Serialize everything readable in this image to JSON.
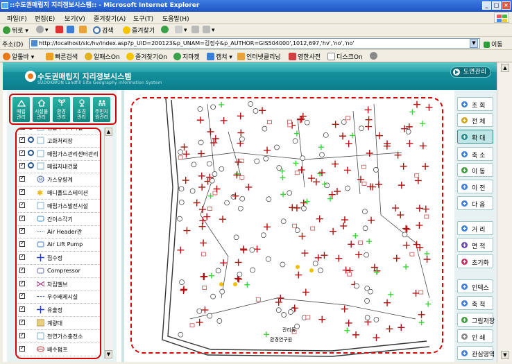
{
  "window": {
    "title": "::수도권매립지 지리정보시스템:: - Microsoft Internet Explorer",
    "controls": [
      "_",
      "□",
      "×"
    ]
  },
  "menu": [
    "파일(F)",
    "편집(E)",
    "보기(V)",
    "즐겨찾기(A)",
    "도구(T)",
    "도움말(H)"
  ],
  "toolbar": {
    "back": "뒤로",
    "search": "검색",
    "favorites": "즐겨찾기"
  },
  "address": {
    "label": "주소(D)",
    "url": "http://localhost/slc/hv/index.asp?p_UID=200123&p_UNAM=김정수&p_AUTHOR=GIS504000',1012,697,'hv','no','no'",
    "go": "이동"
  },
  "links": [
    "알툴바",
    "빠른검색",
    "알패스On",
    "즐겨찾기On",
    "지마켓",
    "캡쳐",
    "인터넷클리닝",
    "영한사전",
    "디스크On"
  ],
  "app": {
    "title": "수도권매립지 지리정보시스템",
    "subtitle": "SUDOKWON Landfill Site Geography Information System",
    "drawing_button": "도면관리"
  },
  "categories": [
    {
      "line1": "매립",
      "line2": "관리",
      "icon": "landfill-icon"
    },
    {
      "line1": "시설물",
      "line2": "관리",
      "icon": "facility-icon"
    },
    {
      "line1": "환경",
      "line2": "관리",
      "icon": "environment-icon"
    },
    {
      "line1": "조경",
      "line2": "관리",
      "icon": "landscape-icon"
    },
    {
      "line1": "주민지",
      "line2": "원관리",
      "icon": "residents-icon"
    }
  ],
  "layers": [
    {
      "name": "침출수저리시설",
      "magnifier": true,
      "icon": "square-icon"
    },
    {
      "name": "고화처리장",
      "magnifier": true,
      "icon": "square-icon"
    },
    {
      "name": "매립가스관리센터관리",
      "magnifier": true,
      "icon": "square-icon"
    },
    {
      "name": "매립지내건물",
      "magnifier": true,
      "icon": "square-icon"
    },
    {
      "name": "가스유량계",
      "magnifier": false,
      "icon": "circle-m-icon"
    },
    {
      "name": "매니폴드스테이션",
      "magnifier": false,
      "icon": "star-icon"
    },
    {
      "name": "매립가스발전시설",
      "magnifier": false,
      "icon": "square-icon"
    },
    {
      "name": "간이소각기",
      "magnifier": false,
      "icon": "burner-icon"
    },
    {
      "name": "Air Header관",
      "magnifier": false,
      "icon": "dotted-line-icon"
    },
    {
      "name": "Air Lift Pump",
      "magnifier": false,
      "icon": "pump-icon"
    },
    {
      "name": "집수정",
      "magnifier": false,
      "icon": "blue-cross-icon"
    },
    {
      "name": "Compressor",
      "magnifier": false,
      "icon": "compressor-icon"
    },
    {
      "name": "차집벨브",
      "magnifier": false,
      "icon": "valve-icon"
    },
    {
      "name": "우수배제시설",
      "magnifier": false,
      "icon": "dashed-line-icon"
    },
    {
      "name": "유출정",
      "magnifier": false,
      "icon": "blue-cross-icon"
    },
    {
      "name": "계량대",
      "magnifier": false,
      "icon": "scale-icon"
    },
    {
      "name": "천연가스충전소",
      "magnifier": false,
      "icon": "square-icon"
    },
    {
      "name": "배수펌프",
      "magnifier": false,
      "icon": "drain-pump-icon"
    }
  ],
  "tools": [
    {
      "label": "조 회",
      "icon": "search-icon"
    },
    {
      "label": "전 체",
      "icon": "full-extent-icon"
    },
    {
      "label": "확 대",
      "icon": "zoom-in-icon"
    },
    {
      "label": "축 소",
      "icon": "zoom-out-icon"
    },
    {
      "label": "이 동",
      "icon": "pan-icon"
    },
    {
      "label": "이 전",
      "icon": "previous-icon"
    },
    {
      "label": "다 음",
      "icon": "next-icon"
    },
    {
      "label": "거 리",
      "icon": "distance-icon"
    },
    {
      "label": "면 적",
      "icon": "area-icon"
    },
    {
      "label": "초기화",
      "icon": "reset-icon"
    },
    {
      "label": "인덱스",
      "icon": "index-icon"
    },
    {
      "label": "축 척",
      "icon": "scale-icon"
    },
    {
      "label": "그림저장",
      "icon": "save-image-icon"
    },
    {
      "label": "인 쇄",
      "icon": "print-icon"
    },
    {
      "label": "관심영역",
      "icon": "interest-area-icon"
    }
  ],
  "map": {
    "labels": [
      "관리동",
      "환경연구원"
    ]
  }
}
